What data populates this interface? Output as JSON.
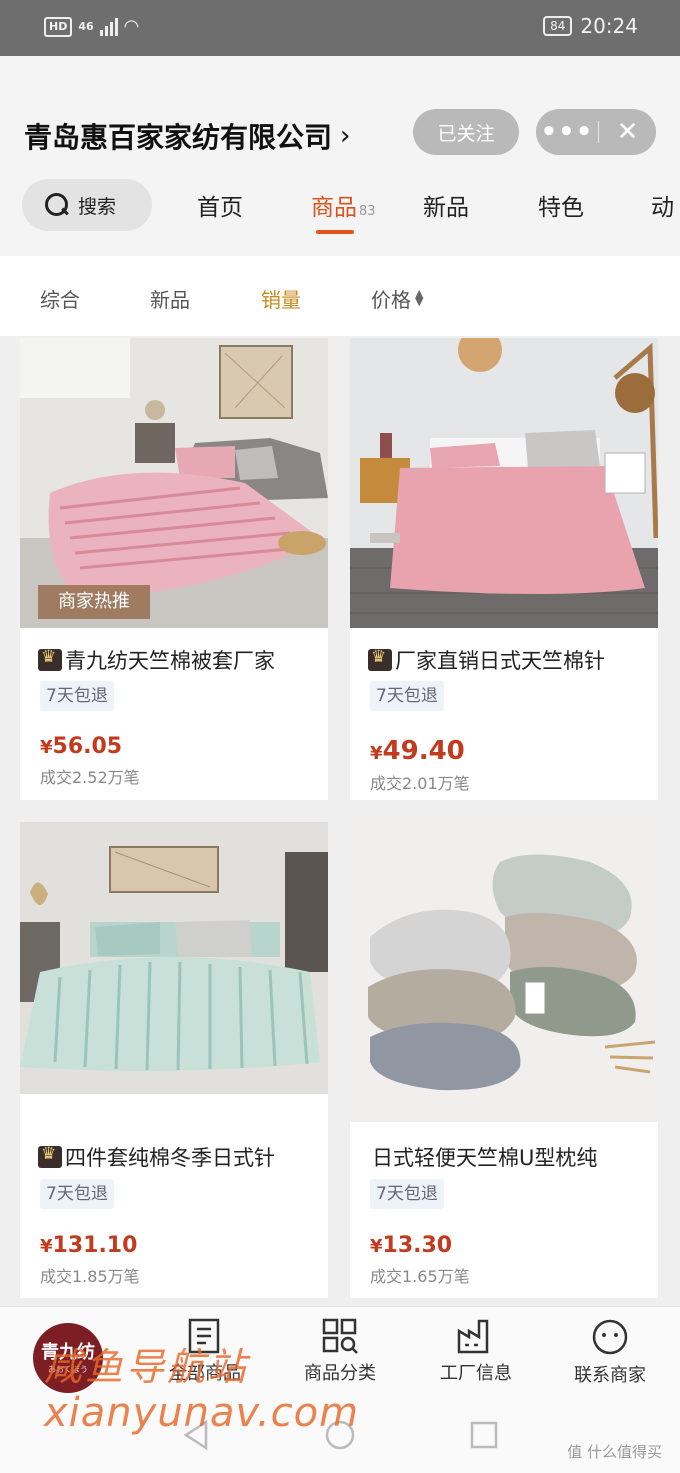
{
  "status_bar": {
    "hd": "HD",
    "network": "46",
    "battery": "84",
    "time": "20:24"
  },
  "header": {
    "shop_name": "青岛惠百家家纺有限公司",
    "follow_label": "已关注",
    "more_label": "•••",
    "close_label": "✕"
  },
  "nav": {
    "search_label": "搜索",
    "tabs": [
      {
        "label": "首页"
      },
      {
        "label": "商品",
        "count": "83"
      },
      {
        "label": "新品"
      },
      {
        "label": "特色"
      },
      {
        "label": "动"
      }
    ]
  },
  "sort": {
    "items": [
      "综合",
      "新品",
      "销量",
      "价格"
    ],
    "active": "销量"
  },
  "products": [
    {
      "title": "青九纺天竺棉被套厂家",
      "badge": "7天包退",
      "currency": "¥",
      "price": "56.05",
      "sold": "成交2.52万笔",
      "tag": "商家热推",
      "crown": true
    },
    {
      "title": "厂家直销日式天竺棉针",
      "badge": "7天包退",
      "currency": "¥",
      "price": "49.40",
      "sold": "成交2.01万笔",
      "crown": true
    },
    {
      "title": "四件套纯棉冬季日式针",
      "badge": "7天包退",
      "currency": "¥",
      "price": "131.10",
      "sold": "成交1.85万笔",
      "crown": true
    },
    {
      "title": "日式轻便天竺棉U型枕纯",
      "badge": "7天包退",
      "currency": "¥",
      "price": "13.30",
      "sold": "成交1.65万笔",
      "crown": false
    }
  ],
  "bottom_nav": {
    "logo_text": "青九纺",
    "logo_sub": "あおくぼう",
    "items": [
      {
        "label": "全部商品",
        "icon": "document-list-icon"
      },
      {
        "label": "商品分类",
        "icon": "category-grid-icon"
      },
      {
        "label": "工厂信息",
        "icon": "factory-icon"
      },
      {
        "label": "联系商家",
        "icon": "chat-face-icon"
      }
    ]
  },
  "watermark": {
    "line1": "咸鱼导航站",
    "line2": "xianyunav.com"
  },
  "corner_mark": "值 什么值得买"
}
